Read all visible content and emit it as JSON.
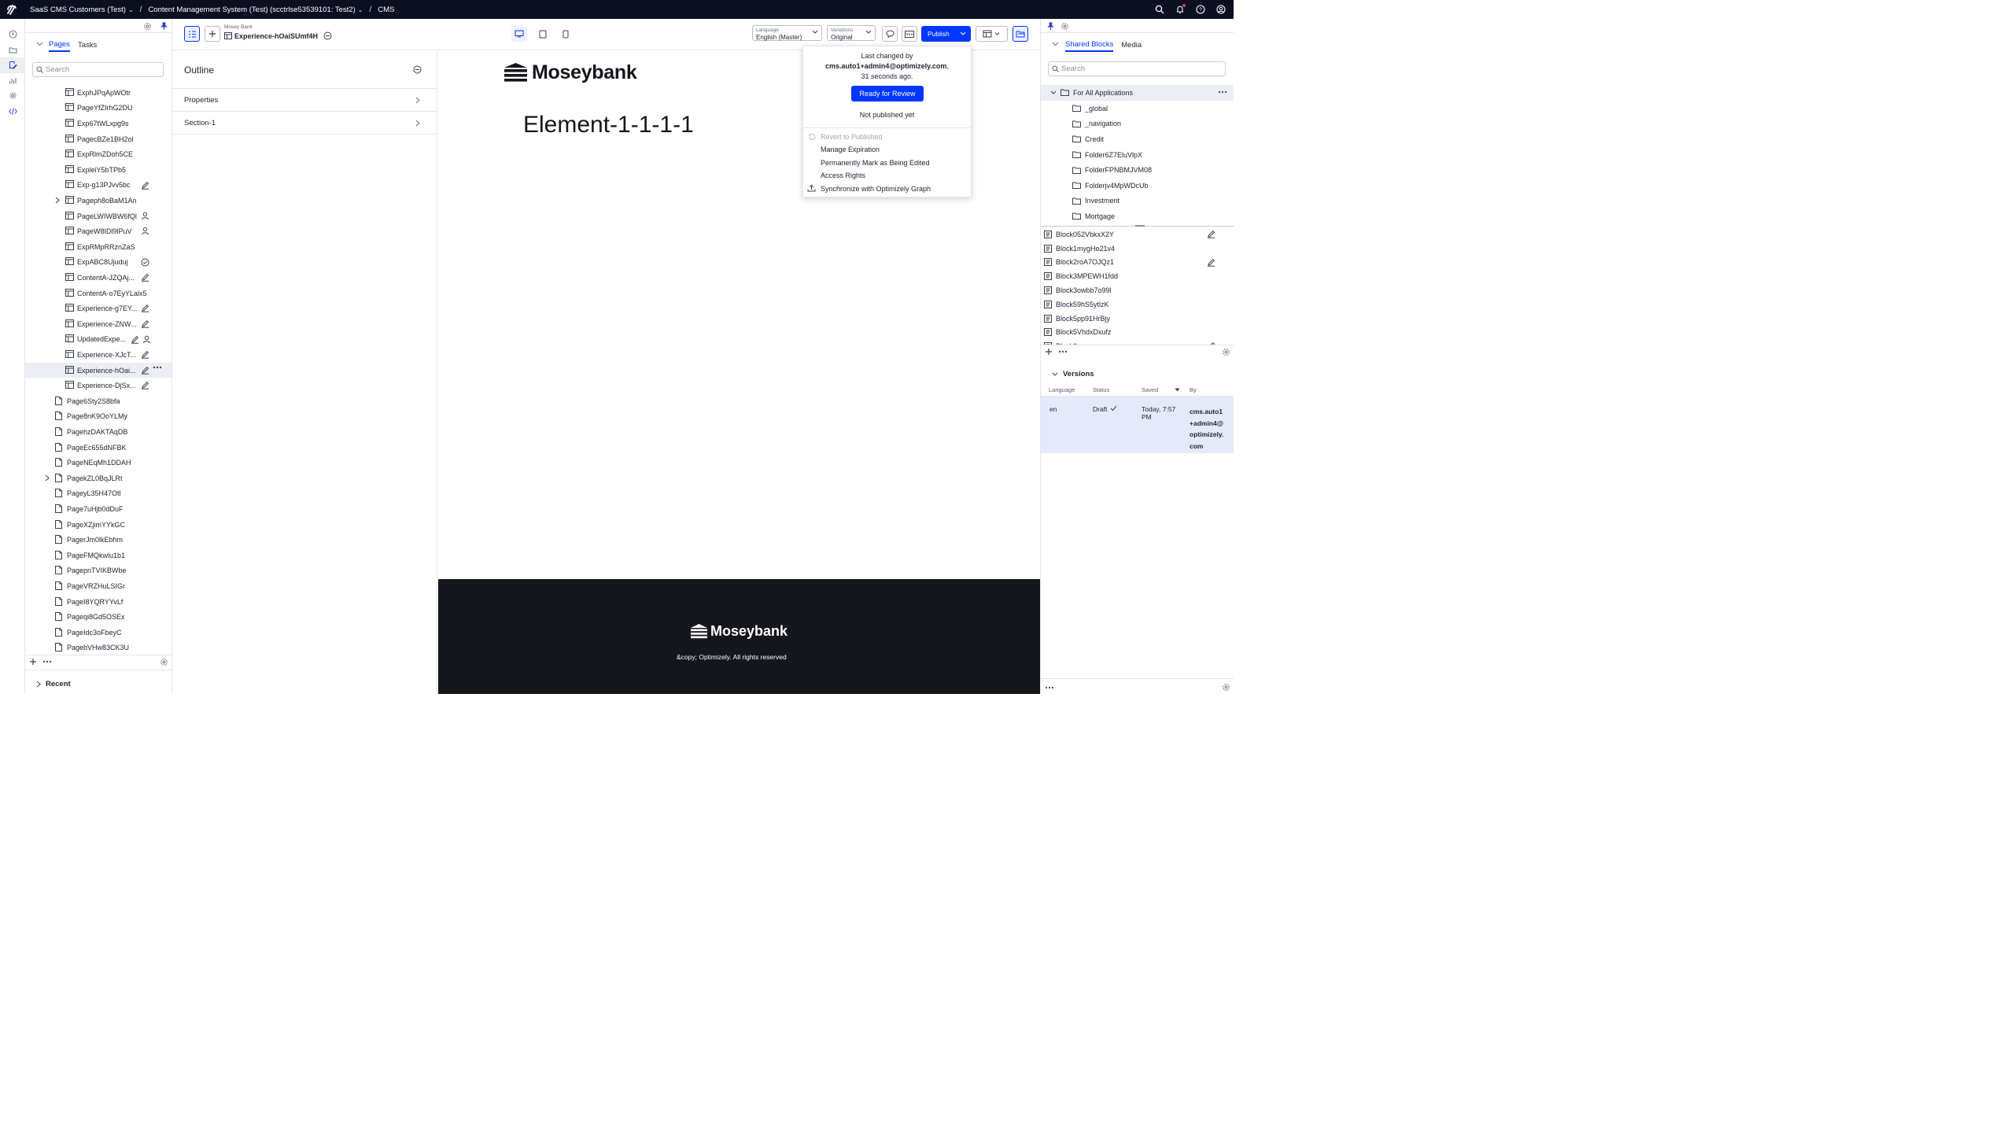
{
  "topbar": {
    "crumb1": "SaaS CMS Customers (Test)",
    "crumb2": "Content Management System (Test) (scctrlse53539101: Test2)",
    "crumb3": "CMS"
  },
  "tree": {
    "tabs": [
      "Pages",
      "Tasks"
    ],
    "search_placeholder": "Search",
    "items": [
      "ExphJPqApWOtr",
      "PageYfZIrhG2DU",
      "Exp67tWLxpg9s",
      "PagecBZe1BH2ol",
      "ExpRlmZDoh5CE",
      "ExpleiY5bTPb5",
      "Exp-g13PJvv5bc",
      "Pageph8oBaM1An",
      "PageLWIWBW6fQl",
      "PageW8IDl9lPuV",
      "ExpRMpRRznZaS",
      "ExpABC8Ujuduj",
      "ContentA-JZQAj...",
      "ContentA-o7EyYLalx5",
      "Experience-g7EY...",
      "Experience-ZNW...",
      "UpdatedExpe...",
      "Experience-XJcT...",
      "Experience-hOai...",
      "Experience-DjSx...",
      "Page6Sty2S8bfa",
      "Page8nK9OoYLMy",
      "PagehzDAKTAqDB",
      "PageEc655dNFBK",
      "PageNEqMh1DDAH",
      "PagekZL0BqJLRt",
      "PageyL35H47Otl",
      "Page7uHjb0dDuF",
      "PageXZjimYYkGC",
      "PagerJm0lkEbhm",
      "PageFMQkwlu1b1",
      "PagepnTVIKBWbe",
      "PageVRZHuLSIGr",
      "PageI8YQRYYvLf",
      "Pageqi8Gd5OSEx",
      "PageIdc3oFbeyC",
      "PagebVHw83CK3U"
    ],
    "recent_label": "Recent"
  },
  "pagebar": {
    "site": "Mosey Bank",
    "title": "Experience-hOaiSUmf4H",
    "language_label": "Language",
    "language_value": "English (Master)",
    "variations_label": "Variations",
    "variations_value": "Original",
    "publish_label": "Publish"
  },
  "outline": {
    "title": "Outline",
    "rows": [
      "Properties",
      "Section-1"
    ]
  },
  "preview": {
    "brand": "Moseybank",
    "heading": "Element-1-1-1-1",
    "footer_brand": "Moseybank",
    "footer_text": "&copy; Optimizely. All rights reserved"
  },
  "popup": {
    "last_changed": "Last changed by",
    "user": "cms.auto1+admin4@optimizely.com",
    "comma": ",",
    "ago": "31 seconds ago.",
    "review_button": "Ready for Review",
    "not_published": "Not published yet",
    "menu": [
      "Revert to Published",
      "Manage Expiration",
      "Permanently Mark as Being Edited",
      "Access Rights",
      "Synchronize with Optimizely Graph"
    ]
  },
  "right": {
    "tabs": [
      "Shared Blocks",
      "Media"
    ],
    "search_placeholder": "Search",
    "root_folder": "For All Applications",
    "folders": [
      "_global",
      "_navigation",
      "Credit",
      "Folder6Z7EluVlpX",
      "FolderFPNBMJVM08",
      "Folderjv4MpWDcUb",
      "Investment",
      "Mortgage"
    ],
    "blocks": [
      "Block052VbkxX2Y",
      "Block1mygHo21v4",
      "Block2roA7OJQz1",
      "Block3MPEWH1fdd",
      "Block3owbb7o99l",
      "Block59hS5ytlzK",
      "Block5pp91HrBjy",
      "Block5VhdxDxufz",
      "Block6..."
    ]
  },
  "versions": {
    "title": "Versions",
    "headers": [
      "Language",
      "Status",
      "Saved",
      "By"
    ],
    "row": {
      "language": "en",
      "status": "Draft",
      "saved": "Today, 7:57 PM",
      "by": "cms.auto1 +admin4@ optimizely. com"
    }
  },
  "colors": {
    "accent": "#0037ff",
    "topbar": "#0c0f22",
    "footer": "#14161c"
  }
}
